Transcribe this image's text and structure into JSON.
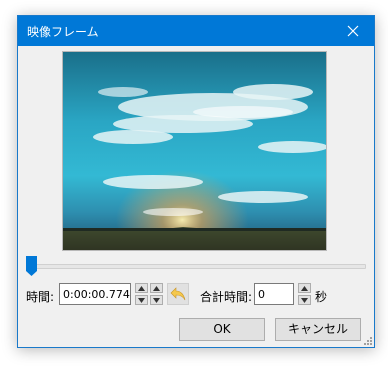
{
  "window": {
    "title": "映像フレーム",
    "close_icon": "close-icon"
  },
  "position": {
    "label": "時間:",
    "value": "0:00:00.774",
    "up_icon": "up-arrow-icon",
    "down_icon": "down-arrow-icon",
    "undo_icon": "undo-arrow-icon"
  },
  "total": {
    "label": "合計時間:",
    "value": "0",
    "unit": "秒"
  },
  "buttons": {
    "ok": "OK",
    "cancel": "キャンセル"
  },
  "slider": {
    "value_fraction": 0.0
  },
  "preview": {
    "description_icon": "sky-landscape-image"
  },
  "colors": {
    "titlebar": "#0078d7",
    "slider_thumb": "#0078d7",
    "undo_arrow": "#f5c84c"
  }
}
